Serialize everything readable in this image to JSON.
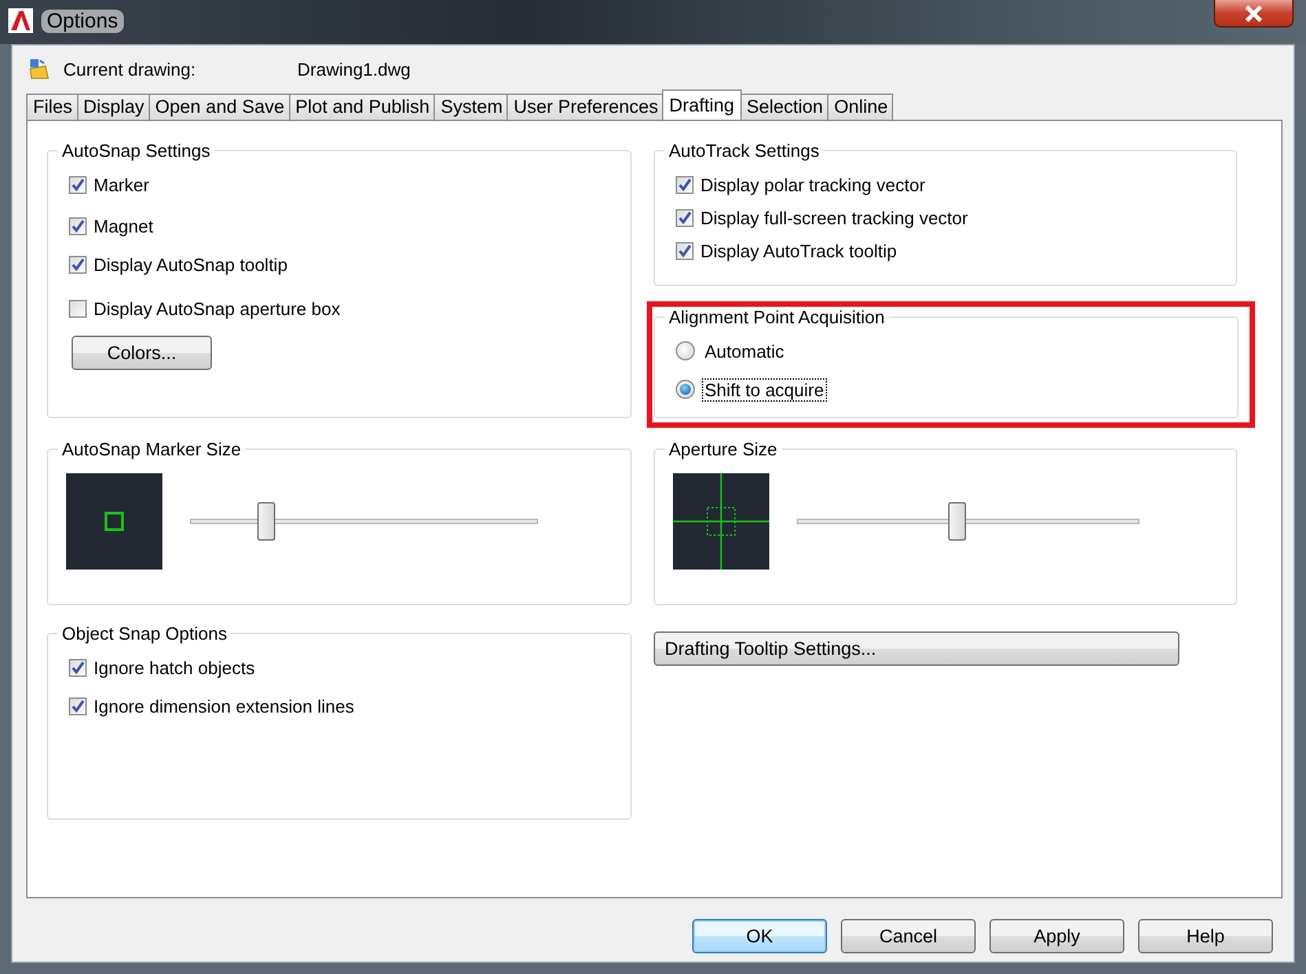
{
  "window": {
    "title": "Options"
  },
  "current_drawing": {
    "label": "Current drawing:",
    "value": "Drawing1.dwg"
  },
  "tabs": [
    {
      "label": "Files",
      "selected": false
    },
    {
      "label": "Display",
      "selected": false
    },
    {
      "label": "Open and Save",
      "selected": false
    },
    {
      "label": "Plot and Publish",
      "selected": false
    },
    {
      "label": "System",
      "selected": false
    },
    {
      "label": "User Preferences",
      "selected": false
    },
    {
      "label": "Drafting",
      "selected": true
    },
    {
      "label": "Selection",
      "selected": false
    },
    {
      "label": "Online",
      "selected": false
    }
  ],
  "autosnap_settings": {
    "title": "AutoSnap Settings",
    "options": [
      {
        "label": "Marker",
        "checked": true
      },
      {
        "label": "Magnet",
        "checked": true
      },
      {
        "label": "Display AutoSnap tooltip",
        "checked": true
      },
      {
        "label": "Display AutoSnap aperture box",
        "checked": false
      }
    ],
    "button": "Colors..."
  },
  "autotrack_settings": {
    "title": "AutoTrack Settings",
    "options": [
      {
        "label": "Display polar tracking vector",
        "checked": true
      },
      {
        "label": "Display full-screen tracking vector",
        "checked": true
      },
      {
        "label": "Display AutoTrack tooltip",
        "checked": true
      }
    ]
  },
  "alignment_point_acquisition": {
    "title": "Alignment Point Acquisition",
    "highlighted": true,
    "options": [
      {
        "label": "Automatic",
        "selected": false,
        "focused": false
      },
      {
        "label": "Shift to acquire",
        "selected": true,
        "focused": true
      }
    ]
  },
  "autosnap_marker_size": {
    "title": "AutoSnap Marker Size",
    "level": 0.22
  },
  "aperture_size": {
    "title": "Aperture Size",
    "level": 0.47
  },
  "object_snap_options": {
    "title": "Object Snap Options",
    "options": [
      {
        "label": "Ignore hatch objects",
        "checked": true
      },
      {
        "label": "Ignore dimension extension lines",
        "checked": true
      }
    ]
  },
  "drafting_tooltip_button": "Drafting Tooltip Settings...",
  "buttons": [
    {
      "label": "OK",
      "default": true
    },
    {
      "label": "Cancel",
      "default": false
    },
    {
      "label": "Apply",
      "default": false
    },
    {
      "label": "Help",
      "default": false
    }
  ]
}
